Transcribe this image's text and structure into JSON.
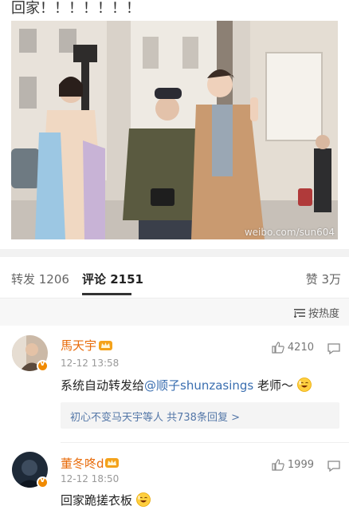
{
  "post": {
    "text": "回家！！！！！！！",
    "watermark": "weibo.com/sun604"
  },
  "tabs": {
    "repost": "转发 1206",
    "comments": "评论 2151",
    "likes": "赞 3万"
  },
  "sort": {
    "label": "按热度"
  },
  "comments": [
    {
      "username": "馬天宇",
      "time": "12-12 13:58",
      "likes": "4210",
      "text_prefix": "系统自动转发给",
      "mention": "@顺子shunzasings",
      "text_suffix": " 老师～",
      "reply_summary": "初心不变马天宇等人 共738条回复 >"
    },
    {
      "username": "董冬咚d",
      "time": "12-12 18:50",
      "likes": "1999",
      "text_prefix": "回家跪搓衣板",
      "mention": "",
      "text_suffix": ""
    }
  ],
  "colors": {
    "username": "#e86b0a",
    "mention": "#3b6fb0",
    "badge": "#f08a00"
  }
}
